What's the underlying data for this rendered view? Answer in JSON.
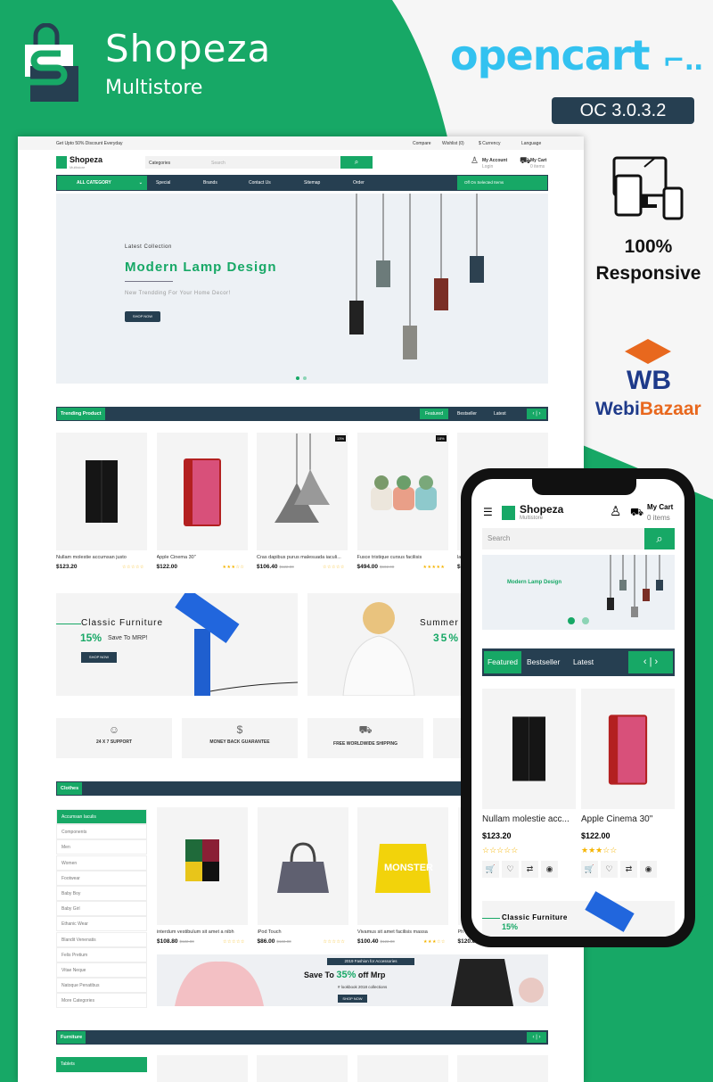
{
  "promo": {
    "brand_name": "Shopeza",
    "brand_sub": "Multistore",
    "platform_logo": "opencart",
    "version": "OC 3.0.3.2",
    "responsive_line1": "100%",
    "responsive_line2": "Responsive",
    "vendor_logo": "WebiBazaar",
    "colors": {
      "green": "#17a866",
      "navy": "#263f51",
      "opencart_blue": "#33c2f0"
    }
  },
  "desktop": {
    "topbar": {
      "promo": "Get Upto 50% Discount Everyday",
      "compare": "Compare",
      "wishlist": "Wishlist (0)",
      "currency": "$ Currency",
      "language": "Language"
    },
    "header": {
      "logo": "Shopeza",
      "logo_sub": "Multistore",
      "categories": "Categories",
      "search_placeholder": "Search",
      "account": "My Account",
      "login": "Login",
      "cart": "My Cart",
      "cart_items": "0 items"
    },
    "nav": {
      "all_category": "ALL CATEGORY",
      "items": [
        "Special",
        "Brands",
        "Contact Us",
        "Sitemap",
        "Order"
      ],
      "offer": "Off On Selected Items"
    },
    "hero": {
      "kicker": "Latest Collection",
      "title": "Modern Lamp Design",
      "subtitle": "New Trendding For Your Home Decor!",
      "button": "SHOP NOW"
    },
    "trending": {
      "title": "Trending Product",
      "tabs": [
        "Featured",
        "Bestseller",
        "Latest"
      ],
      "products": [
        {
          "name": "Nullam molestie accumsan justo",
          "price": "$123.20",
          "old": "",
          "rating": 0,
          "badge": ""
        },
        {
          "name": "Apple Cinema 30\"",
          "price": "$122.00",
          "old": "",
          "rating": 3,
          "badge": ""
        },
        {
          "name": "Cras dapibus purus malesuada iaculi...",
          "price": "$106.40",
          "old": "$122.00",
          "rating": 0,
          "badge": "13%"
        },
        {
          "name": "Fusce tristique cursus facilisis",
          "price": "$494.00",
          "old": "$602.00",
          "rating": 5,
          "badge": "18%"
        },
        {
          "name": "la",
          "price": "$1",
          "old": "",
          "rating": 0,
          "badge": ""
        }
      ]
    },
    "banners": [
      {
        "title": "Classic Furniture",
        "pct": "15%",
        "text": "Save To MRP!",
        "button": "SHOP NOW"
      },
      {
        "title": "Summer",
        "pct": "35%"
      }
    ],
    "features": [
      "24 X 7 SUPPORT",
      "MONEY BACK GUARANTEE",
      "FREE WORLDWIDE SHIPPING"
    ],
    "clothes": {
      "title": "Clothes",
      "categories": [
        "Accumsan Iaculis",
        "Components",
        "Men",
        "Women",
        "Footwear",
        "Baby Boy",
        "Baby Girl",
        "Ethanic Wear",
        "Blandit Venenatis",
        "Felis Pretium",
        "Vitae Neque",
        "Natoque Penatibus",
        "More Categories"
      ],
      "products": [
        {
          "name": "interdum vestibulum sit amet a nibh",
          "price": "$108.80",
          "old": "$122.00",
          "rating": 0
        },
        {
          "name": "iPod Touch",
          "price": "$86.00",
          "old": "$122.00",
          "rating": 0
        },
        {
          "name": "Vivamus sit amet facilisis massa",
          "price": "$100.40",
          "old": "$122.00",
          "rating": 3
        },
        {
          "name": "Ph",
          "price": "$120.0",
          "old": "",
          "rating": 0
        }
      ],
      "banner": {
        "tag": "2019 Fashion for Accessories",
        "pre": "Save To",
        "pct": "35%",
        "post": "off Mrp",
        "sub": "# lookbook 2018 collections",
        "button": "SHOP NOW"
      }
    },
    "furniture": {
      "title": "Furniture",
      "first_category": "Tablets"
    }
  },
  "mobile": {
    "logo": "Shopeza",
    "logo_sub": "Multistore",
    "cart": "My Cart",
    "cart_items": "0 items",
    "search_placeholder": "Search",
    "hero_title": "Modern Lamp Design",
    "tabs": [
      "Featured",
      "Bestseller",
      "Latest"
    ],
    "products": [
      {
        "name": "Nullam molestie acc...",
        "price": "$123.20",
        "rating": 0
      },
      {
        "name": "Apple Cinema 30\"",
        "price": "$122.00",
        "rating": 3
      }
    ],
    "banner_title": "Classic Furniture",
    "banner_pct": "15%"
  }
}
